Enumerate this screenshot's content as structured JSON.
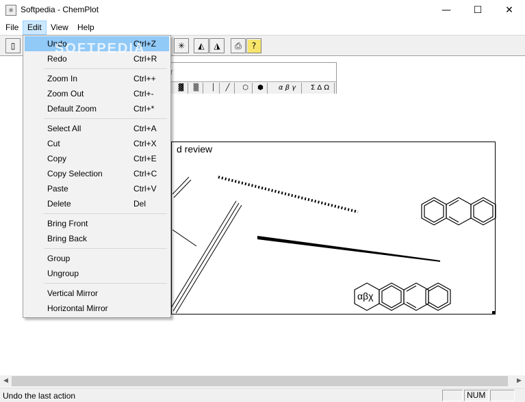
{
  "window": {
    "title": "Softpedia - ChemPlot",
    "app_icon": "chemplot-app-icon",
    "controls": {
      "minimize": "—",
      "maximize": "☐",
      "close": "✕"
    }
  },
  "menubar": {
    "items": [
      {
        "label": "File"
      },
      {
        "label": "Edit",
        "active": true
      },
      {
        "label": "View"
      },
      {
        "label": "Help"
      }
    ]
  },
  "toolbar": {
    "buttons": [
      {
        "name": "new-document-icon",
        "glyph": "▯"
      },
      {
        "name": "asterisk-icon",
        "glyph": "✳"
      },
      {
        "name": "flip-horizontal-icon",
        "glyph": "◭"
      },
      {
        "name": "flip-vertical-icon",
        "glyph": "◮"
      },
      {
        "name": "print-icon",
        "glyph": "⎙"
      },
      {
        "name": "help-icon",
        "glyph": "?"
      }
    ]
  },
  "palette": {
    "title_fragment": "r",
    "tools": [
      {
        "name": "fill-pattern-icon",
        "glyph": "▓"
      },
      {
        "name": "fill-pattern-alt-icon",
        "glyph": "▒"
      },
      {
        "name": "single-bond-icon",
        "glyph": "│"
      },
      {
        "name": "diagonal-bond-icon",
        "glyph": "╱"
      },
      {
        "name": "hexagon-icon",
        "glyph": "⬡"
      },
      {
        "name": "hexagon-filled-icon",
        "glyph": "⬢"
      },
      {
        "name": "greek-lower-button",
        "glyph": "α β γ"
      },
      {
        "name": "greek-upper-button",
        "glyph": "Σ Δ Ω"
      }
    ]
  },
  "document": {
    "title_fragment": "d review",
    "greek_label": "αβχ"
  },
  "edit_menu": {
    "items": [
      {
        "label": "Undo",
        "shortcut": "Ctrl+Z",
        "highlighted": true
      },
      {
        "label": "Redo",
        "shortcut": "Ctrl+R"
      },
      {
        "separator": true
      },
      {
        "label": "Zoom In",
        "shortcut": "Ctrl++"
      },
      {
        "label": "Zoom Out",
        "shortcut": "Ctrl+-"
      },
      {
        "label": "Default Zoom",
        "shortcut": "Ctrl+*"
      },
      {
        "separator": true
      },
      {
        "label": "Select All",
        "shortcut": "Ctrl+A"
      },
      {
        "label": "Cut",
        "shortcut": "Ctrl+X"
      },
      {
        "label": "Copy",
        "shortcut": "Ctrl+E"
      },
      {
        "label": "Copy Selection",
        "shortcut": "Ctrl+C"
      },
      {
        "label": "Paste",
        "shortcut": "Ctrl+V"
      },
      {
        "label": "Delete",
        "shortcut": "Del"
      },
      {
        "separator": true
      },
      {
        "label": "Bring Front",
        "shortcut": ""
      },
      {
        "label": "Bring Back",
        "shortcut": ""
      },
      {
        "separator": true
      },
      {
        "label": "Group",
        "shortcut": ""
      },
      {
        "label": "Ungroup",
        "shortcut": ""
      },
      {
        "separator": true
      },
      {
        "label": "Vertical Mirror",
        "shortcut": ""
      },
      {
        "label": "Horizontal Mirror",
        "shortcut": ""
      }
    ]
  },
  "watermark": "SOFTPEDIA",
  "scrollbar": {
    "left_arrow": "◀",
    "right_arrow": "▶"
  },
  "statusbar": {
    "message": "Undo the last action",
    "cells": [
      "",
      "NUM",
      ""
    ]
  },
  "colors": {
    "menu_highlight": "#91c9f7",
    "menubar_active": "#cce8ff"
  }
}
